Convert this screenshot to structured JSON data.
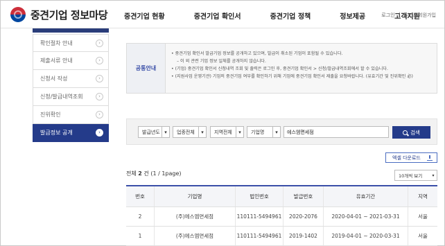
{
  "header": {
    "logo_text": "중견기업 정보마당",
    "nav": [
      "중견기업 현황",
      "중견기업 확인서",
      "중견기업 정책",
      "정보제공",
      "고객지원"
    ],
    "util": [
      "로그인",
      "|",
      "시스템회원가입"
    ]
  },
  "sidebar": {
    "items": [
      {
        "label": "확인절차 안내",
        "active": false
      },
      {
        "label": "제출서류 안내",
        "active": false
      },
      {
        "label": "신청서 작성",
        "active": false
      },
      {
        "label": "신청/발급내역조회",
        "active": false
      },
      {
        "label": "진위확인",
        "active": false
      },
      {
        "label": "발급정보 공개",
        "active": true
      }
    ],
    "arrow": "›"
  },
  "notice": {
    "title": "공통안내",
    "lines": [
      "• 중견기업 확인서 발급기업 정보를 공개하고 있으며, 발급이 취소된 기업이 포함될 수 있습니다.",
      "– 이 외 관련 기업 정보 일체를 공개하지 않습니다.",
      "• (기업) 중견기업 확인서 신청내역 조회 및 출력은 로그인 후, 중견기업 확인서 > 신청/발급내역조회에서 할 수 있습니다.",
      "• (지원사업 운영기관) 기업의 중견기업 여부를 확인하기 위해 기업에 중견기업 확인서 제출을 요청바랍니다. (유효기간 및 진위확인 必)"
    ]
  },
  "search": {
    "year": "발급년도",
    "industry": "업종전체",
    "region": "지역전체",
    "field": "기업명",
    "keyword": "에스엠면세점",
    "button": "검색",
    "caret": "▾"
  },
  "excel_button": "엑셀 다운로드",
  "summary": {
    "prefix": "전체",
    "count": "2",
    "unit": "건",
    "pages": "(1 / 1page)"
  },
  "per_page": "10개씩 보기",
  "table": {
    "headers": [
      "번호",
      "기업명",
      "법인번호",
      "발급번호",
      "유효기간",
      "지역"
    ],
    "rows": [
      [
        "2",
        "(주)에스엠면세점",
        "110111-5494961",
        "2020-2076",
        "2020-04-01 ~ 2021-03-31",
        "서울"
      ],
      [
        "1",
        "(주)에스엠면세점",
        "110111-5494961",
        "2019-1402",
        "2019-04-01 ~ 2020-03-31",
        "서울"
      ]
    ]
  },
  "colors": {
    "primary": "#243b8a",
    "accent": "#3a4fa8",
    "logo_red": "#cd2e3a",
    "logo_blue": "#0047a0"
  }
}
